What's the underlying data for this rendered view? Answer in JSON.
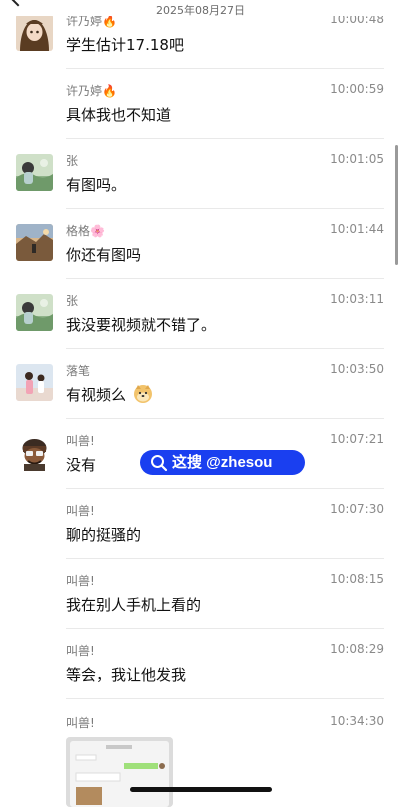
{
  "header": {
    "top_text": "",
    "date": "2025年08月27日"
  },
  "messages": [
    {
      "name": "许乃婷",
      "name_emoji": "🔥",
      "time": "10:00:48",
      "text": "学生估计17.18吧",
      "avatar": "avatar-girl"
    },
    {
      "name": "许乃婷",
      "name_emoji": "🔥",
      "time": "10:00:59",
      "text": "具体我也不知道",
      "avatar": ""
    },
    {
      "name": "张",
      "name_emoji": "",
      "time": "10:01:05",
      "text": "有图吗。",
      "avatar": "avatar-landscape-green"
    },
    {
      "name": "格格",
      "name_emoji": "🌸",
      "time": "10:01:44",
      "text": "你还有图吗",
      "avatar": "avatar-sunset"
    },
    {
      "name": "张",
      "name_emoji": "",
      "time": "10:03:11",
      "text": "我没要视频就不错了。",
      "avatar": "avatar-landscape-green"
    },
    {
      "name": "落笔",
      "name_emoji": "",
      "time": "10:03:50",
      "text": "有视频么",
      "text_emoji": "doge",
      "avatar": "avatar-people"
    },
    {
      "name": "叫兽!",
      "name_emoji": "",
      "time": "10:07:21",
      "text": "没有",
      "avatar": "avatar-cartoon"
    },
    {
      "name": "叫兽!",
      "name_emoji": "",
      "time": "10:07:30",
      "text": "聊的挺骚的",
      "avatar": ""
    },
    {
      "name": "叫兽!",
      "name_emoji": "",
      "time": "10:08:15",
      "text": "我在别人手机上看的",
      "avatar": ""
    },
    {
      "name": "叫兽!",
      "name_emoji": "",
      "time": "10:08:29",
      "text": "等会，我让他发我",
      "avatar": ""
    },
    {
      "name": "叫兽!",
      "name_emoji": "",
      "time": "10:34:30",
      "text": "",
      "avatar": ""
    }
  ],
  "watermark": {
    "text": "这搜 @zhesou",
    "color": "#1a3ff0"
  }
}
